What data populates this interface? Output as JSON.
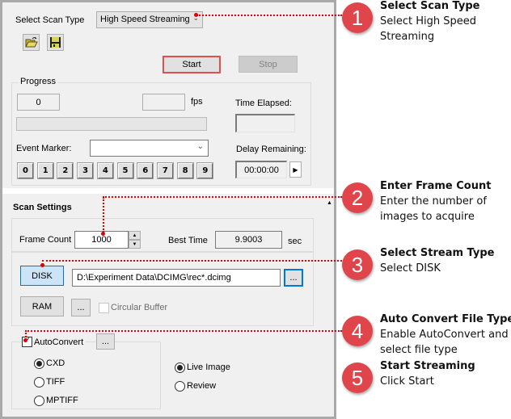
{
  "dialog": {
    "scan_type": {
      "label": "Select Scan Type",
      "selected": "High Speed Streaming",
      "arrow_icon": "chevron-down"
    },
    "toolbar": {
      "open_icon": "open-folder-icon",
      "save_icon": "save-disk-icon"
    },
    "actions": {
      "start_label": "Start",
      "stop_label": "Stop"
    },
    "progress": {
      "group_title": "Progress",
      "frames_value": "0",
      "fps_value": "",
      "fps_unit": "fps",
      "time_elapsed_label": "Time Elapsed:",
      "time_elapsed_value": "",
      "progress_fraction": 0,
      "event_marker_label": "Event Marker:",
      "event_marker_value": "",
      "marker_buttons": [
        "0",
        "1",
        "2",
        "3",
        "4",
        "5",
        "6",
        "7",
        "8",
        "9"
      ],
      "delay_remaining_label": "Delay Remaining:",
      "delay_remaining_value": "00:00:00",
      "delay_play_icon": "play-icon"
    },
    "scan_settings": {
      "section_title": "Scan Settings",
      "collapse_icon": "collapse-up-icon",
      "frame_count_label": "Frame Count",
      "frame_count_value": "1000",
      "best_time_label": "Best Time",
      "best_time_value": "9.9003",
      "best_time_unit": "sec",
      "disk_label": "DISK",
      "disk_path": "D:\\Experiment Data\\DCIMG\\rec*.dcimg",
      "browse_label": "...",
      "ram_label": "RAM",
      "ram_browse_label": "...",
      "circular_buffer_label": "Circular Buffer",
      "circular_buffer_checked": false,
      "autoconvert_label": "AutoConvert",
      "autoconvert_checked": true,
      "autoconvert_options_label": "...",
      "file_types": [
        {
          "label": "CXD",
          "checked": true
        },
        {
          "label": "TIFF",
          "checked": false
        },
        {
          "label": "MPTIFF",
          "checked": false
        }
      ],
      "view_modes": [
        {
          "label": "Live Image",
          "checked": true
        },
        {
          "label": "Review",
          "checked": false
        }
      ]
    }
  },
  "callouts": [
    {
      "number": "1",
      "title": "Select Scan Type",
      "description": "Select High Speed Streaming"
    },
    {
      "number": "2",
      "title": "Enter Frame Count",
      "description": "Enter the number of images to acquire"
    },
    {
      "number": "3",
      "title": "Select Stream Type",
      "description": "Select DISK"
    },
    {
      "number": "4",
      "title": "Auto Convert File Type",
      "description": "Enable AutoConvert and select file type"
    },
    {
      "number": "5",
      "title": "Start Streaming",
      "description": "Click Start"
    }
  ],
  "colors": {
    "callout_badge": "#e0454c",
    "callout_line": "#e00000",
    "start_highlight": "#e05050",
    "disk_selected": "#cce4f7",
    "disk_selected_border": "#0078d7"
  }
}
